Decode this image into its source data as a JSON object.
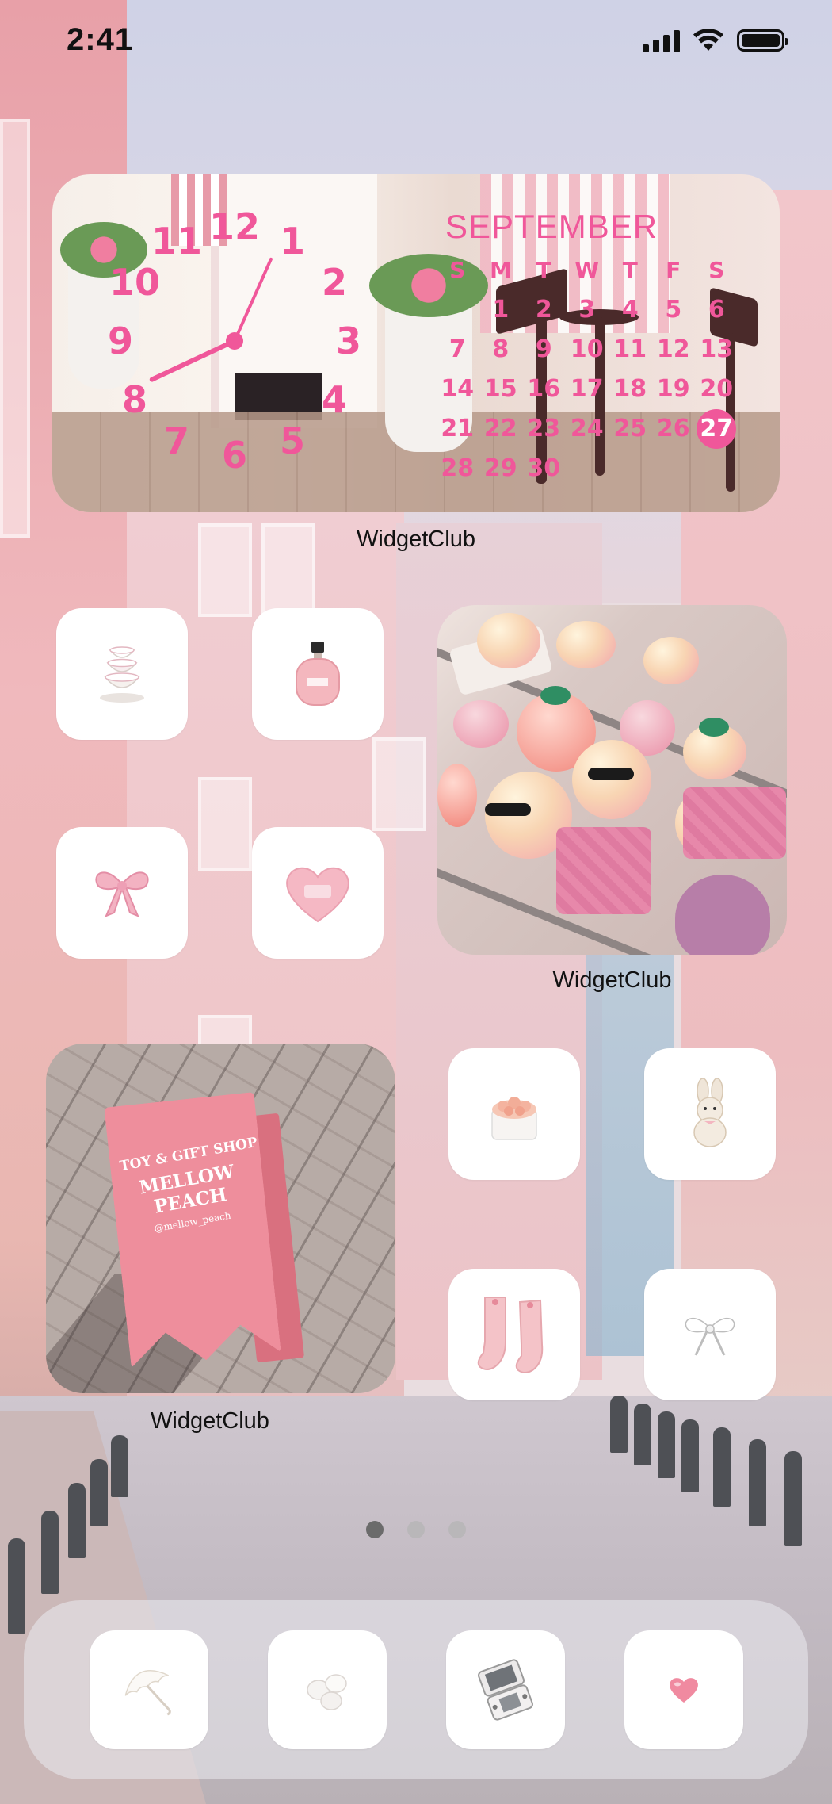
{
  "status_bar": {
    "time": "2:41"
  },
  "clock_widget": {
    "numbers": [
      "12",
      "1",
      "2",
      "3",
      "4",
      "5",
      "6",
      "7",
      "8",
      "9",
      "10",
      "11"
    ],
    "hour_hand": "8",
    "minute_hand": "1"
  },
  "calendar_widget": {
    "month": "SEPTEMBER",
    "weekdays": [
      "S",
      "M",
      "T",
      "W",
      "T",
      "F",
      "S"
    ],
    "days": [
      [
        "",
        "1",
        "2",
        "3",
        "4",
        "5",
        "6"
      ],
      [
        "7",
        "8",
        "9",
        "10",
        "11",
        "12",
        "13"
      ],
      [
        "14",
        "15",
        "16",
        "17",
        "18",
        "19",
        "20"
      ],
      [
        "21",
        "22",
        "23",
        "24",
        "25",
        "26",
        "27"
      ],
      [
        "28",
        "29",
        "30",
        "",
        "",
        "",
        ""
      ]
    ],
    "today": "27"
  },
  "widget_labels": {
    "top": "WidgetClub",
    "right": "WidgetClub",
    "bottom": "WidgetClub"
  },
  "sign_widget": {
    "line1": "TOY & GIFT SHOP",
    "line2": "MELLOW PEACH",
    "line3": "@mellow_peach"
  },
  "apps": [
    {
      "name": "teacups-app",
      "icon": "teacups-icon"
    },
    {
      "name": "perfume-app",
      "icon": "perfume-bottle-icon"
    },
    {
      "name": "bow-app",
      "icon": "pink-bow-icon"
    },
    {
      "name": "heart-pillow-app",
      "icon": "heart-pillow-icon"
    },
    {
      "name": "roses-box-app",
      "icon": "rose-box-icon"
    },
    {
      "name": "bunny-app",
      "icon": "bunny-plush-icon"
    },
    {
      "name": "socks-app",
      "icon": "pink-socks-icon"
    },
    {
      "name": "white-bow-app",
      "icon": "white-bow-icon"
    }
  ],
  "dock": [
    {
      "name": "umbrella-app",
      "icon": "lace-umbrella-icon"
    },
    {
      "name": "marshmallow-app",
      "icon": "marshmallow-icon"
    },
    {
      "name": "console-app",
      "icon": "handheld-console-icon"
    },
    {
      "name": "heart-app",
      "icon": "small-heart-icon"
    }
  ],
  "page_dots": {
    "count": 3,
    "active": 0
  },
  "colors": {
    "accent_pink": "#f0579a",
    "label_text": "#111111",
    "icon_bg": "#ffffff"
  }
}
